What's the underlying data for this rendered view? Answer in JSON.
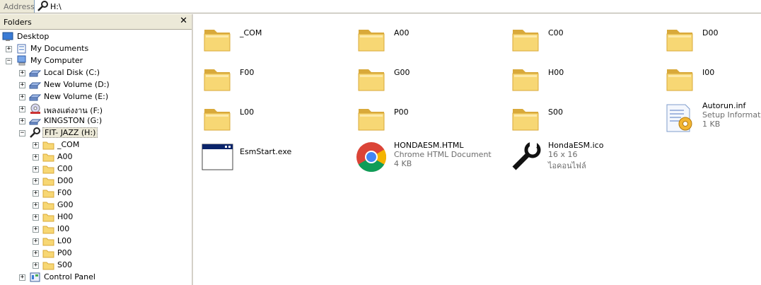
{
  "address": {
    "label": "Address",
    "value": "H:\\"
  },
  "folders_pane": {
    "title": "Folders",
    "close": "✕"
  },
  "tree": [
    {
      "label": "Desktop",
      "icon": "desktop-icon",
      "expander": "",
      "level": 0
    },
    {
      "label": "My Documents",
      "icon": "my-documents-icon",
      "expander": "+",
      "level": 1
    },
    {
      "label": "My Computer",
      "icon": "my-computer-icon",
      "expander": "−",
      "level": 1
    },
    {
      "label": "Local Disk (C:)",
      "icon": "hard-drive-icon",
      "expander": "+",
      "level": 2
    },
    {
      "label": "New Volume (D:)",
      "icon": "hard-drive-icon",
      "expander": "+",
      "level": 2
    },
    {
      "label": "New Volume (E:)",
      "icon": "hard-drive-icon",
      "expander": "+",
      "level": 2
    },
    {
      "label": "เพลงแต่งงาน (F:)",
      "icon": "cd-drive-icon",
      "expander": "+",
      "level": 2
    },
    {
      "label": "KINGSTON (G:)",
      "icon": "removable-drive-icon",
      "expander": "+",
      "level": 2
    },
    {
      "label": "FIT- JAZZ (H:)",
      "icon": "wrench-drive-icon",
      "expander": "−",
      "level": 2,
      "selected": true
    },
    {
      "label": "_COM",
      "icon": "folder-icon",
      "expander": "+",
      "level": 3
    },
    {
      "label": "A00",
      "icon": "folder-icon",
      "expander": "+",
      "level": 3
    },
    {
      "label": "C00",
      "icon": "folder-icon",
      "expander": "+",
      "level": 3
    },
    {
      "label": "D00",
      "icon": "folder-icon",
      "expander": "+",
      "level": 3
    },
    {
      "label": "F00",
      "icon": "folder-icon",
      "expander": "+",
      "level": 3
    },
    {
      "label": "G00",
      "icon": "folder-icon",
      "expander": "+",
      "level": 3
    },
    {
      "label": "H00",
      "icon": "folder-icon",
      "expander": "+",
      "level": 3
    },
    {
      "label": "I00",
      "icon": "folder-icon",
      "expander": "+",
      "level": 3
    },
    {
      "label": "L00",
      "icon": "folder-icon",
      "expander": "+",
      "level": 3
    },
    {
      "label": "P00",
      "icon": "folder-icon",
      "expander": "+",
      "level": 3
    },
    {
      "label": "S00",
      "icon": "folder-icon",
      "expander": "+",
      "level": 3
    },
    {
      "label": "Control Panel",
      "icon": "control-panel-icon",
      "expander": "+",
      "level": 2
    }
  ],
  "items": [
    {
      "name": "_COM",
      "type": "folder"
    },
    {
      "name": "A00",
      "type": "folder"
    },
    {
      "name": "C00",
      "type": "folder"
    },
    {
      "name": "D00",
      "type": "folder"
    },
    {
      "name": "F00",
      "type": "folder"
    },
    {
      "name": "G00",
      "type": "folder"
    },
    {
      "name": "H00",
      "type": "folder"
    },
    {
      "name": "I00",
      "type": "folder"
    },
    {
      "name": "L00",
      "type": "folder"
    },
    {
      "name": "P00",
      "type": "folder"
    },
    {
      "name": "S00",
      "type": "folder"
    },
    {
      "name": "Autorun.inf",
      "type": "inf",
      "sub1": "Setup Information",
      "sub2": "1 KB"
    },
    {
      "name": "EsmStart.exe",
      "type": "exe"
    },
    {
      "name": "HONDAESM.HTML",
      "type": "chrome",
      "sub1": "Chrome HTML Document",
      "sub2": "4 KB"
    },
    {
      "name": "HondaESM.ico",
      "type": "ico",
      "sub1": "16 x 16",
      "sub2": "ไอคอนไฟล์"
    }
  ],
  "colors": {
    "folder": "#f7d774",
    "folder_dark": "#d9a93a",
    "selection": "#ece9d8",
    "pane_header": "#ece9d8"
  }
}
